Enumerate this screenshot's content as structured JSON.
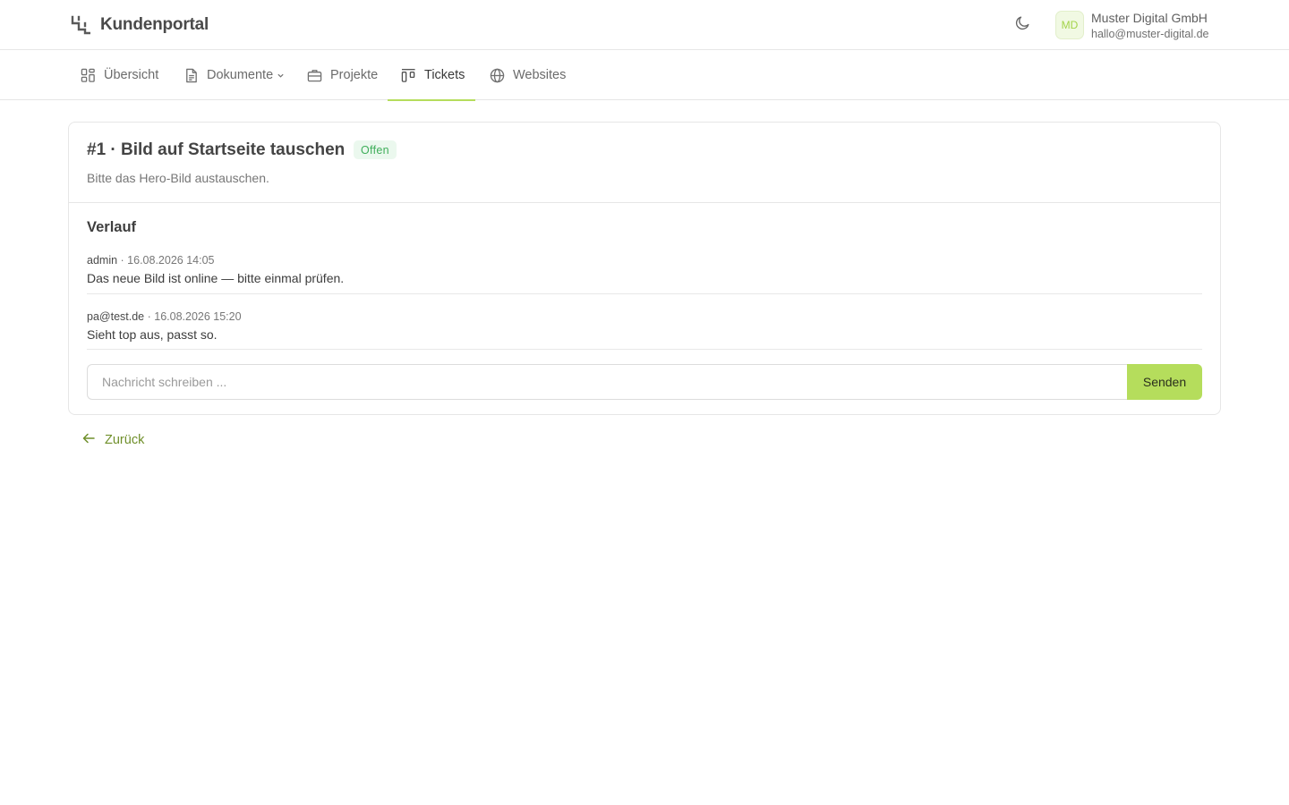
{
  "header": {
    "app_title": "Kundenportal",
    "logo_icon": "stairs-logo-icon",
    "theme_toggle_icon": "moon-icon",
    "account": {
      "avatar_initials": "MD",
      "company": "Muster Digital GmbH",
      "email": "hallo@muster-digital.de"
    }
  },
  "nav": {
    "items": [
      {
        "label": "Übersicht",
        "icon": "dashboard-icon",
        "active": false
      },
      {
        "label": "Dokumente",
        "icon": "document-icon",
        "active": false,
        "has_dropdown": true
      },
      {
        "label": "Projekte",
        "icon": "briefcase-icon",
        "active": false
      },
      {
        "label": "Tickets",
        "icon": "kanban-icon",
        "active": true
      },
      {
        "label": "Websites",
        "icon": "globe-icon",
        "active": false
      }
    ]
  },
  "ticket": {
    "title": "#1 · Bild auf Startseite tauschen",
    "status": "Offen",
    "description": "Bitte das Hero-Bild austauschen."
  },
  "history": {
    "title": "Verlauf",
    "entries": [
      {
        "author": "admin",
        "timestamp": "· 16.08.2026 14:05",
        "text": "Das neue Bild ist online — bitte einmal prüfen."
      },
      {
        "author": "pa@test.de",
        "timestamp": "· 16.08.2026 15:20",
        "text": "Sieht top aus, passt so."
      }
    ]
  },
  "composer": {
    "placeholder": "Nachricht schreiben ...",
    "value": "",
    "send_label": "Senden"
  },
  "back": {
    "label": "Zurück",
    "icon": "arrow-left-icon"
  },
  "colors": {
    "accent": "#b5dd5c",
    "status_open_bg": "#ebf8ee",
    "status_open_text": "#3fae5a",
    "link": "#6f8f2a"
  }
}
